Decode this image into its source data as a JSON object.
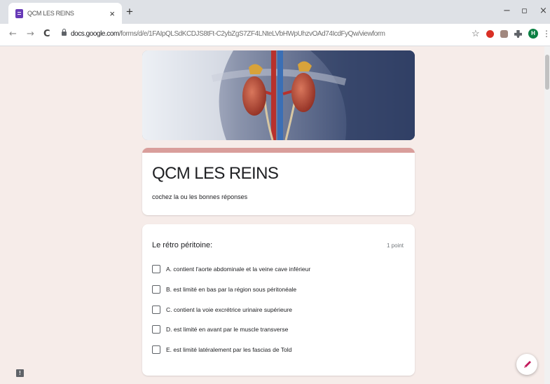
{
  "browser": {
    "tab_title": "QCM LES REINS",
    "tab_close": "×",
    "new_tab": "+",
    "minimize": "−",
    "restore": "▫",
    "close": "×",
    "back": "←",
    "forward": "→",
    "reload": "C",
    "url_host": "docs.google.com",
    "url_path": "/forms/d/e/1FAIpQLSdKCDJS8tFt-C2ybZgS7ZF4LNteLVbHWpUhzvOAd74IcdFyQw/viewform",
    "bookmark": "☆",
    "profile_initial": "H",
    "menu": "⋮",
    "extension_colors": [
      "#d93025",
      "#a1887f",
      "#5f6368"
    ]
  },
  "form": {
    "title": "QCM LES REINS",
    "description": "cochez la ou les bonnes réponses",
    "accent_color": "#d99e9b",
    "question": {
      "title": "Le rétro péritoine:",
      "points": "1 point",
      "options": [
        {
          "label": "A. contient l'aorte abdominale et la veine cave inférieur",
          "checked": false
        },
        {
          "label": "B. est limité en bas par la région sous péritonéale",
          "checked": false
        },
        {
          "label": "C. contient la voie excrétrice urinaire supérieure",
          "checked": false
        },
        {
          "label": "D. est limité en avant par le muscle transverse",
          "checked": false
        },
        {
          "label": "E. est limité latéralement par les fascias de Told",
          "checked": false
        }
      ]
    },
    "edit_icon": "pencil-icon",
    "report_label": "!"
  }
}
